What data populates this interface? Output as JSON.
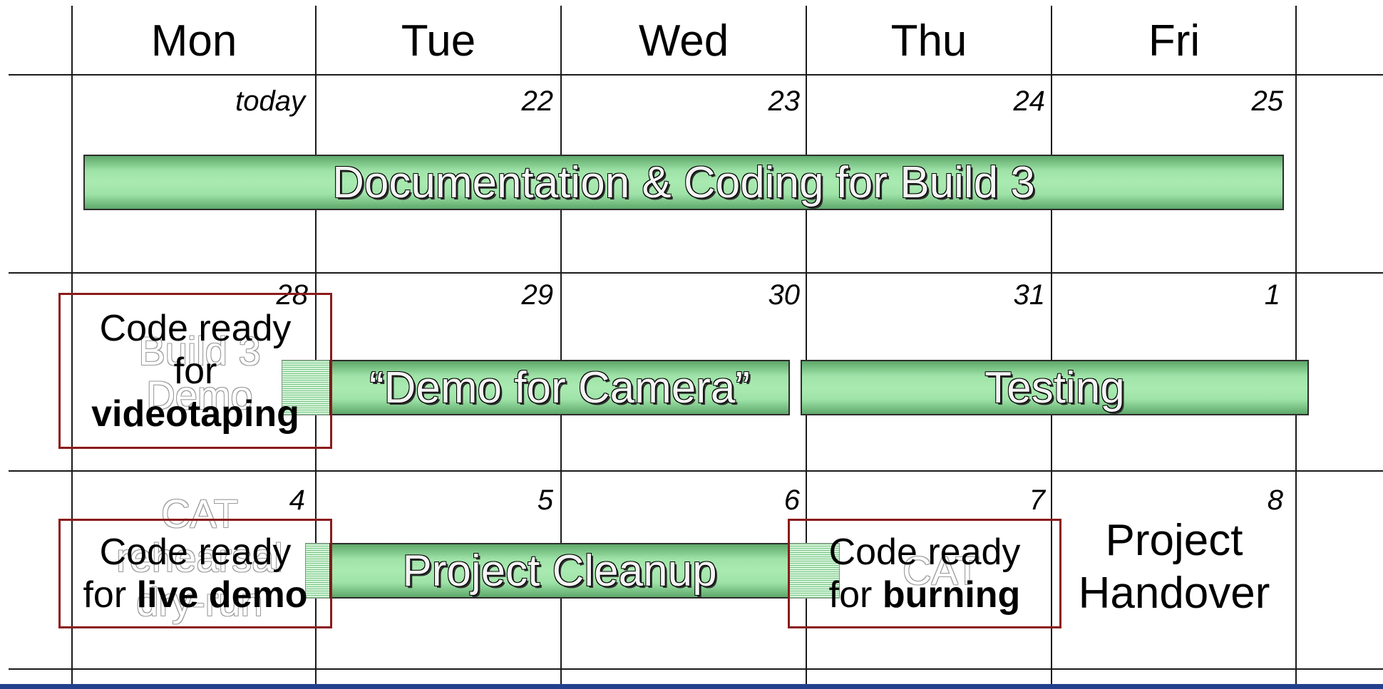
{
  "weekdays": [
    "Mon",
    "Tue",
    "Wed",
    "Thu",
    "Fri"
  ],
  "weeks": [
    [
      "today",
      "22",
      "23",
      "24",
      "25"
    ],
    [
      "28",
      "29",
      "30",
      "31",
      "1"
    ],
    [
      "4",
      "5",
      "6",
      "7",
      "8"
    ]
  ],
  "events": {
    "doc_coding": "Documentation & Coding for Build 3",
    "demo_camera": "“Demo for Camera”",
    "testing": "Testing",
    "cleanup": "Project Cleanup",
    "handover_line1": "Project",
    "handover_line2": "Handover"
  },
  "milestones": {
    "videotaping": {
      "line1": "Code ready",
      "line2": "for",
      "bold": "videotaping"
    },
    "live_demo": {
      "line1": "Code ready",
      "line2": "for ",
      "bold": "live demo"
    },
    "burning": {
      "line1": "Code ready",
      "line2": "for ",
      "bold": "burning"
    }
  },
  "ghost_text": {
    "build3_demo_line1": "Build 3",
    "build3_demo_line2": "Demo",
    "cat_rehearsal_line1": "CAT",
    "cat_rehearsal_line2": "rehearsal",
    "cat_rehearsal_line3": "dry-run",
    "cat": "CAT"
  },
  "colors": {
    "bar_green": "#9fe3a8",
    "milestone_border": "#8b1b1b",
    "footer_blue": "#23408e"
  }
}
